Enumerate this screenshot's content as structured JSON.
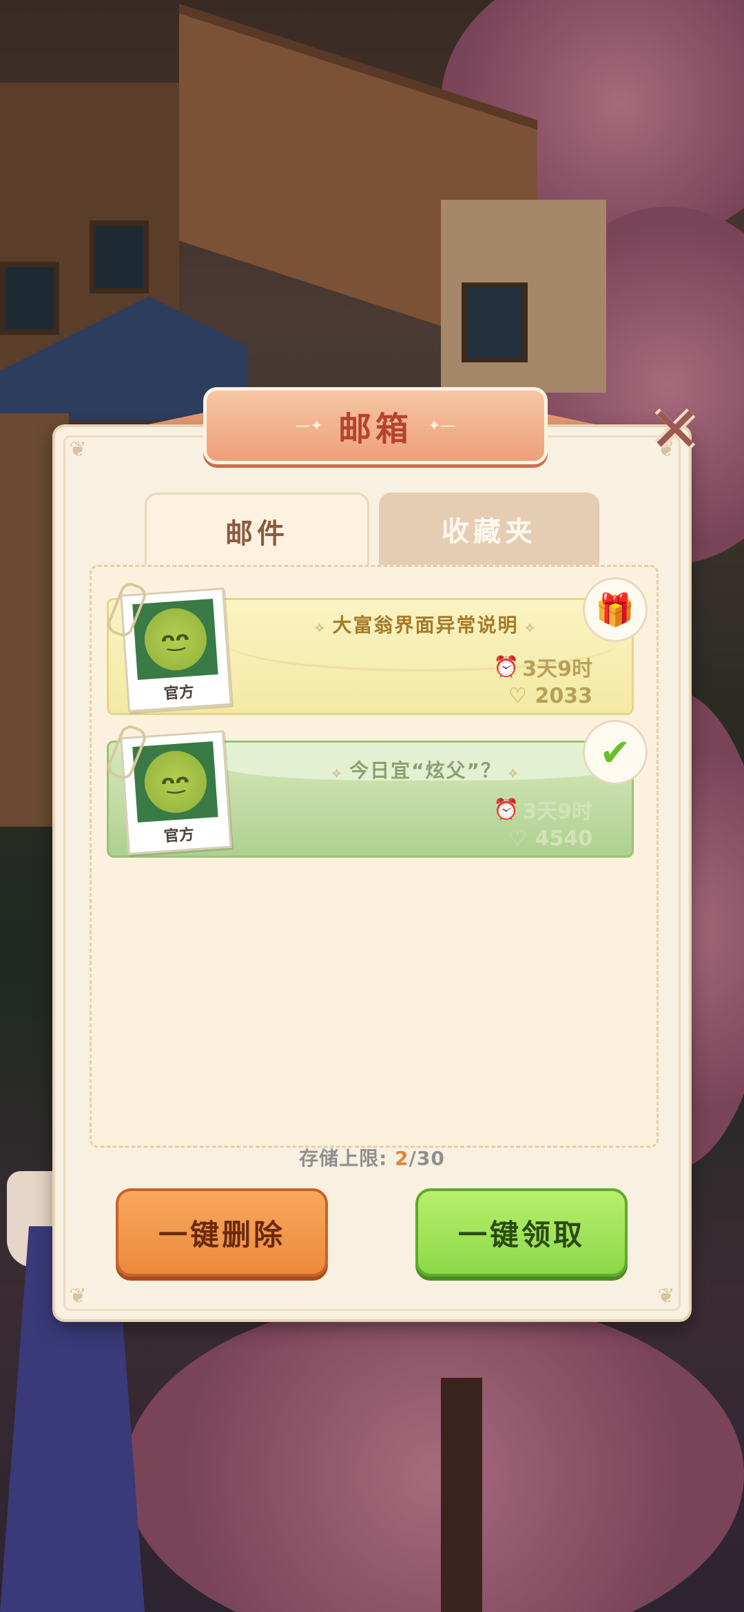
{
  "title": "邮箱",
  "tabs": [
    {
      "label": "邮件",
      "active": true
    },
    {
      "label": "收藏夹",
      "active": false
    }
  ],
  "mails": [
    {
      "title": "大富翁界面异常说明",
      "sender": "官方",
      "time_left": "3天9时",
      "likes": "2033",
      "status": "gift",
      "status_icon": "gift-icon"
    },
    {
      "title": "今日宜“炫父”？",
      "sender": "官方",
      "time_left": "3天9时",
      "likes": "4540",
      "status": "claimed",
      "status_icon": "check-icon"
    }
  ],
  "storage": {
    "label": "存储上限: ",
    "current": "2",
    "separator": "/",
    "max": "30"
  },
  "buttons": {
    "delete_all": "一键删除",
    "claim_all": "一键领取"
  },
  "colors": {
    "panel_bg": "#f8f0e0",
    "title_text": "#b5432d",
    "delete_button": "#ec8a3c",
    "claim_button": "#8cd84a",
    "storage_current": "#e08536"
  }
}
